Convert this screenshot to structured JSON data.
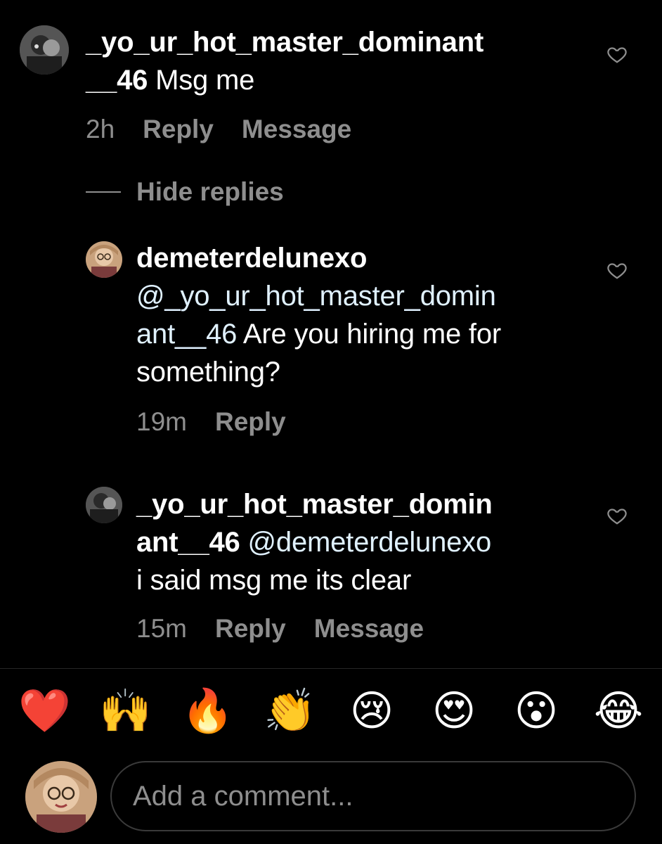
{
  "comments": [
    {
      "username": "_yo_ur_hot_master_dominant__46",
      "username_line1": "_yo_ur_hot_master_dominant",
      "username_line2": "__46",
      "text": "Msg me",
      "time": "2h",
      "reply_label": "Reply",
      "message_label": "Message"
    }
  ],
  "hide_replies_label": "Hide replies",
  "replies": [
    {
      "username": "demeterdelunexo",
      "mention_line1": "@_yo_ur_hot_master_domin",
      "mention_line2": "ant__46",
      "text_line2": " Are you hiring me for",
      "text_line3": "something?",
      "time": "19m",
      "reply_label": "Reply"
    },
    {
      "username_line1": "_yo_ur_hot_master_domin",
      "username_line2": "ant__46",
      "mention": " @demeterdelunexo",
      "text": "i said msg me its clear",
      "time": "15m",
      "reply_label": "Reply",
      "message_label": "Message"
    }
  ],
  "emoji_bar": [
    {
      "name": "red-heart",
      "glyph": "❤️"
    },
    {
      "name": "raising-hands",
      "glyph": "🙌"
    },
    {
      "name": "fire",
      "glyph": "🔥"
    },
    {
      "name": "clapping-hands",
      "glyph": "👏"
    },
    {
      "name": "crying-face",
      "glyph": "😢"
    },
    {
      "name": "heart-eyes",
      "glyph": "😍"
    },
    {
      "name": "surprised-face",
      "glyph": "😮"
    },
    {
      "name": "tears-of-joy",
      "glyph": "😂"
    }
  ],
  "composer": {
    "placeholder": "Add a comment..."
  },
  "colors": {
    "background": "#000000",
    "text": "#ffffff",
    "secondary": "#8e8e8e",
    "mention": "#e0f1ff",
    "border": "#3a3a3a"
  }
}
